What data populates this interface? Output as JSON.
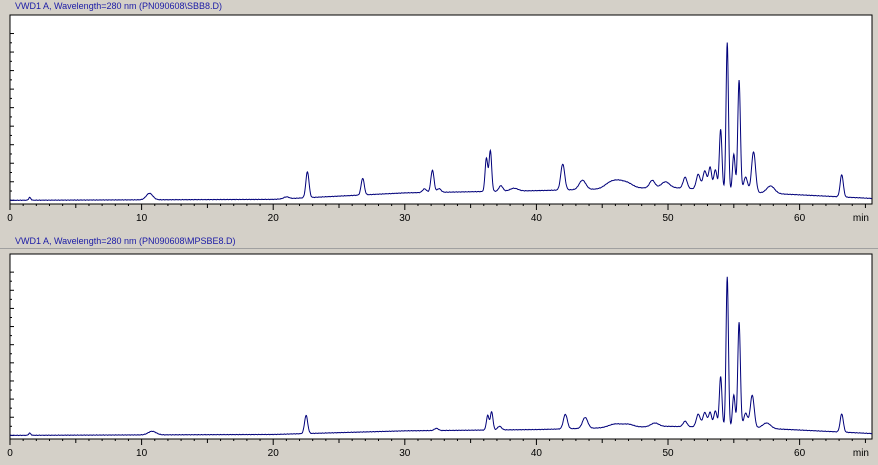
{
  "chart_data": [
    {
      "type": "line",
      "title": "VWD1 A, Wavelength=280 nm (PN090608\\SBB8.D)",
      "xlabel": "min",
      "xlim": [
        0,
        65.5
      ],
      "ylim": [
        -2,
        100
      ],
      "x_ticks": [
        0,
        10,
        20,
        30,
        40,
        50,
        60
      ],
      "x_tick_labels": [
        "0",
        "10",
        "20",
        "30",
        "40",
        "50",
        "60"
      ],
      "baseline": {
        "x": [
          0,
          20,
          30,
          40,
          50,
          57,
          65.5
        ],
        "y": [
          0,
          0.5,
          4,
          5.2,
          7,
          4,
          1
        ]
      },
      "peaks": [
        [
          1.5,
          1.5,
          0.08
        ],
        [
          10.6,
          3.5,
          0.25
        ],
        [
          21.0,
          1,
          0.2
        ],
        [
          22.6,
          14,
          0.12
        ],
        [
          26.8,
          9,
          0.12
        ],
        [
          31.5,
          2,
          0.15
        ],
        [
          32.1,
          12,
          0.12
        ],
        [
          32.6,
          2,
          0.15
        ],
        [
          36.2,
          18,
          0.1
        ],
        [
          36.5,
          22,
          0.1
        ],
        [
          37.3,
          3,
          0.15
        ],
        [
          38.3,
          1.5,
          0.3
        ],
        [
          42.0,
          14,
          0.15
        ],
        [
          43.5,
          5,
          0.25
        ],
        [
          45.5,
          2,
          0.4
        ],
        [
          46.2,
          4,
          0.5
        ],
        [
          47.0,
          2,
          0.4
        ],
        [
          48.8,
          4,
          0.2
        ],
        [
          49.8,
          3,
          0.3
        ],
        [
          51.3,
          6,
          0.15
        ],
        [
          52.3,
          8,
          0.15
        ],
        [
          52.8,
          10,
          0.15
        ],
        [
          53.2,
          12,
          0.12
        ],
        [
          53.6,
          11,
          0.12
        ],
        [
          54.0,
          33,
          0.1
        ],
        [
          54.5,
          80,
          0.09
        ],
        [
          55.0,
          20,
          0.1
        ],
        [
          55.4,
          60,
          0.1
        ],
        [
          55.9,
          8,
          0.15
        ],
        [
          56.5,
          22,
          0.15
        ],
        [
          57.8,
          4,
          0.3
        ],
        [
          63.2,
          12,
          0.12
        ]
      ]
    },
    {
      "type": "line",
      "title": "VWD1 A, Wavelength=280 nm (PN090608\\MPSBE8.D)",
      "xlabel": "min",
      "xlim": [
        0,
        65.5
      ],
      "ylim": [
        -2,
        100
      ],
      "x_ticks": [
        0,
        10,
        20,
        30,
        40,
        50,
        60
      ],
      "x_tick_labels": [
        "0",
        "10",
        "20",
        "30",
        "40",
        "50",
        "60"
      ],
      "baseline": {
        "x": [
          0,
          20,
          30,
          40,
          50,
          57,
          65.5
        ],
        "y": [
          0,
          0.5,
          2.5,
          3.2,
          5,
          4,
          1
        ]
      },
      "peaks": [
        [
          1.5,
          1.2,
          0.08
        ],
        [
          10.8,
          2,
          0.3
        ],
        [
          22.5,
          10,
          0.12
        ],
        [
          32.4,
          1.2,
          0.15
        ],
        [
          36.3,
          8,
          0.1
        ],
        [
          36.6,
          10,
          0.1
        ],
        [
          37.2,
          2,
          0.15
        ],
        [
          42.2,
          8,
          0.15
        ],
        [
          43.7,
          6,
          0.2
        ],
        [
          46.0,
          2,
          0.5
        ],
        [
          47.0,
          1.5,
          0.4
        ],
        [
          49.0,
          2,
          0.3
        ],
        [
          51.3,
          3,
          0.15
        ],
        [
          52.3,
          7,
          0.15
        ],
        [
          52.8,
          8,
          0.15
        ],
        [
          53.2,
          8,
          0.12
        ],
        [
          53.6,
          9,
          0.12
        ],
        [
          54.0,
          28,
          0.1
        ],
        [
          54.5,
          83,
          0.09
        ],
        [
          55.0,
          18,
          0.1
        ],
        [
          55.4,
          58,
          0.1
        ],
        [
          55.9,
          8,
          0.15
        ],
        [
          56.4,
          18,
          0.15
        ],
        [
          57.5,
          3,
          0.3
        ],
        [
          63.2,
          10,
          0.12
        ]
      ]
    }
  ]
}
